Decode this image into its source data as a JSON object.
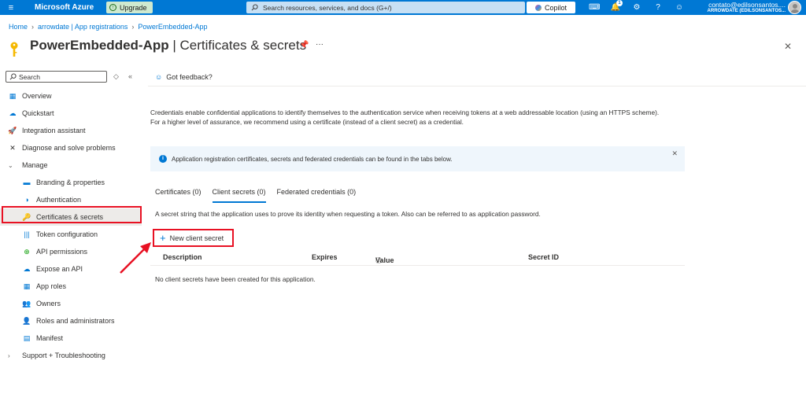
{
  "topbar": {
    "brand": "Microsoft Azure",
    "upgrade_label": "Upgrade",
    "search_placeholder": "Search resources, services, and docs (G+/)",
    "copilot_label": "Copilot",
    "notification_count": "1",
    "user_email": "contato@edilsonsantos....",
    "user_tenant": "ARROWDATE (EDILSONSANTOS..."
  },
  "breadcrumb": [
    "Home",
    "arrowdate | App registrations",
    "PowerEmbedded-App"
  ],
  "page": {
    "title_app": "PowerEmbedded-App",
    "title_sep": " | ",
    "title_section": "Certificates & secrets"
  },
  "nav": {
    "search_placeholder": "Search",
    "items": [
      {
        "label": "Overview",
        "icon": "overview-icon"
      },
      {
        "label": "Quickstart",
        "icon": "quickstart-icon"
      },
      {
        "label": "Integration assistant",
        "icon": "rocket-icon"
      },
      {
        "label": "Diagnose and solve problems",
        "icon": "wrench-icon"
      },
      {
        "label": "Manage",
        "icon": "chevron-down-icon"
      },
      {
        "label": "Branding & properties",
        "icon": "branding-icon"
      },
      {
        "label": "Authentication",
        "icon": "authentication-icon"
      },
      {
        "label": "Certificates & secrets",
        "icon": "key-icon"
      },
      {
        "label": "Token configuration",
        "icon": "token-icon"
      },
      {
        "label": "API permissions",
        "icon": "api-permissions-icon"
      },
      {
        "label": "Expose an API",
        "icon": "cloud-icon"
      },
      {
        "label": "App roles",
        "icon": "app-roles-icon"
      },
      {
        "label": "Owners",
        "icon": "owners-icon"
      },
      {
        "label": "Roles and administrators",
        "icon": "roles-icon"
      },
      {
        "label": "Manifest",
        "icon": "manifest-icon"
      },
      {
        "label": "Support + Troubleshooting",
        "icon": "chevron-right-icon"
      }
    ]
  },
  "main": {
    "feedback_label": "Got feedback?",
    "intro": "Credentials enable confidential applications to identify themselves to the authentication service when receiving tokens at a web addressable location (using an HTTPS scheme). For a higher level of assurance, we recommend using a certificate (instead of a client secret) as a credential.",
    "info_text": "Application registration certificates, secrets and federated credentials can be found in the tabs below.",
    "tabs": [
      "Certificates (0)",
      "Client secrets (0)",
      "Federated credentials (0)"
    ],
    "selected_tab": "Client secrets (0)",
    "description": "A secret string that the application uses to prove its identity when requesting a token. Also can be referred to as application password.",
    "new_button": "New client secret",
    "columns": [
      "Description",
      "Expires",
      "Value",
      "Secret ID"
    ],
    "empty_message": "No client secrets have been created for this application."
  },
  "colors": {
    "accent": "#0078d4",
    "highlight": "#e81123"
  }
}
